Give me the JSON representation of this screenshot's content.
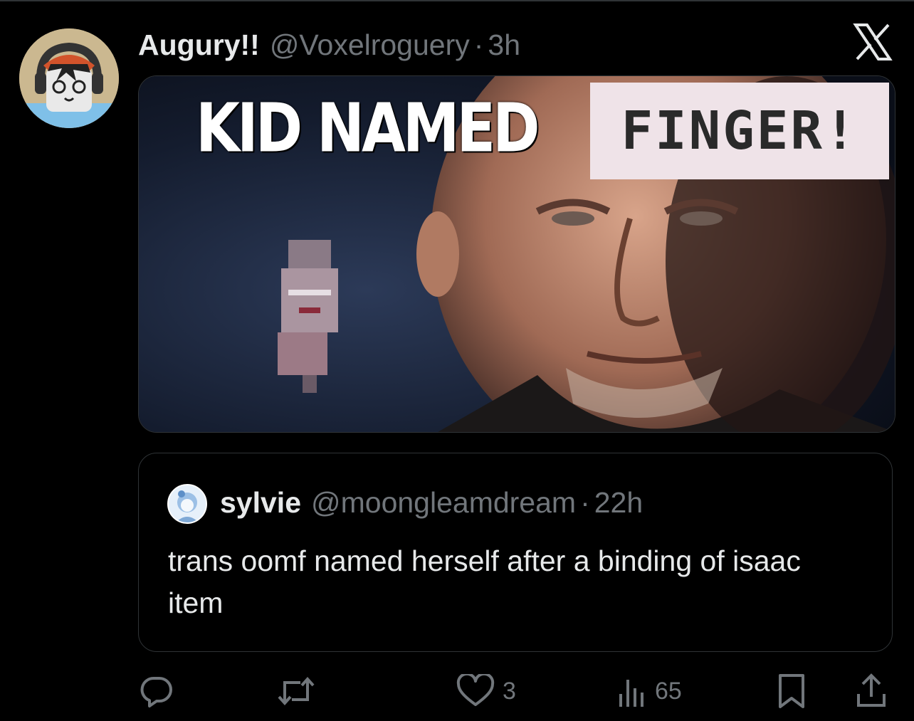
{
  "post": {
    "author_name": "Augury!!",
    "author_handle": "@Voxelroguery",
    "separator": "·",
    "time": "3h"
  },
  "media": {
    "caption_top": "KID NAMED",
    "caption_box": "FINGER!"
  },
  "quoted_post": {
    "author_name": "sylvie",
    "author_handle": "@moongleamdream",
    "separator": "·",
    "time": "22h",
    "text": "trans oomf named herself after a binding of isaac item"
  },
  "actions": {
    "reply_icon": "reply-icon",
    "repost_icon": "repost-icon",
    "like_icon": "heart-icon",
    "like_count": "3",
    "views_icon": "views-icon",
    "views_count": "65",
    "bookmark_icon": "bookmark-icon",
    "share_icon": "share-icon"
  },
  "colors": {
    "background": "#000000",
    "text_primary": "#e7e9ea",
    "text_secondary": "#71767b",
    "border": "#2f3336"
  }
}
